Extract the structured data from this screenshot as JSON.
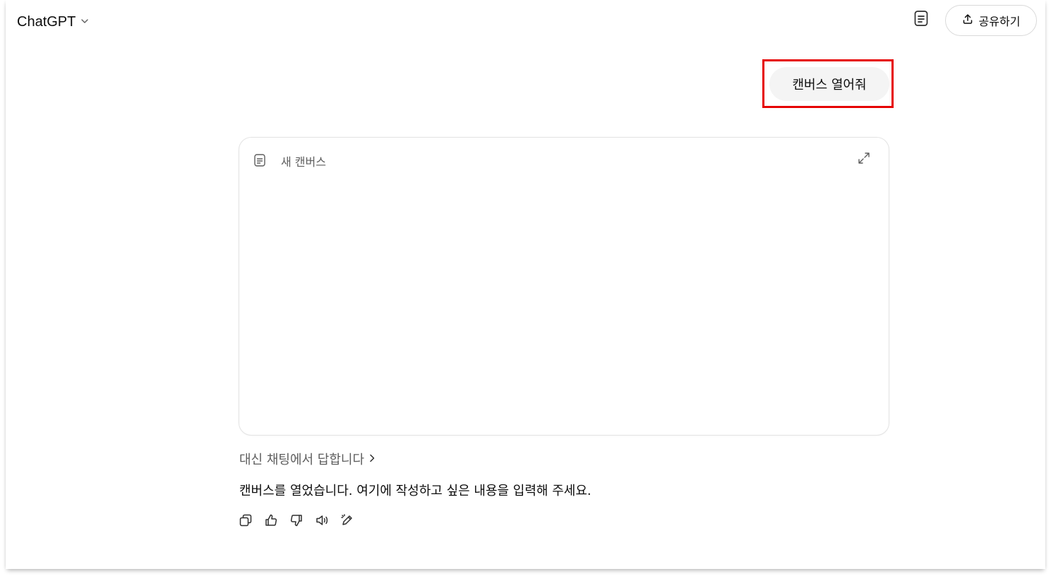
{
  "header": {
    "model_name": "ChatGPT",
    "share_label": "공유하기"
  },
  "conversation": {
    "user_message": "캔버스 열어줘",
    "canvas": {
      "title": "새 캔버스"
    },
    "answer_in_chat_label": "대신 채팅에서 답합니다",
    "assistant_message": "캔버스를 열었습니다. 여기에 작성하고 싶은 내용을 입력해 주세요."
  },
  "icons": {
    "model_dropdown": "chevron-down-icon",
    "header_doc": "document-icon",
    "share": "upload-icon",
    "canvas_doc": "document-icon",
    "canvas_expand": "expand-icon",
    "answer_chevron": "chevron-right-icon",
    "actions": [
      "copy-icon",
      "thumbs-up-icon",
      "thumbs-down-icon",
      "speaker-icon",
      "edit-pencil-icon"
    ]
  },
  "colors": {
    "highlight": "#e60000",
    "user_bubble": "#f4f4f4",
    "muted_text": "#5d5d5d"
  }
}
